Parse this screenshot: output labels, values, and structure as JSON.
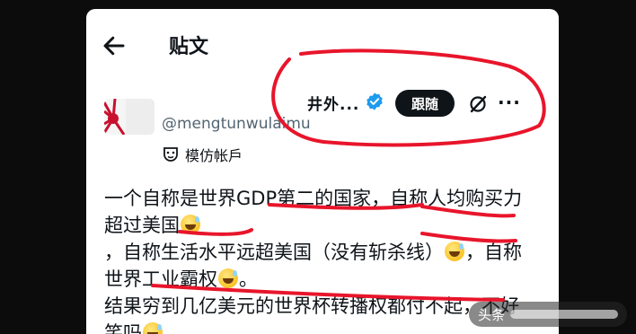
{
  "header": {
    "title": "贴文"
  },
  "author": {
    "display_name": "井外...",
    "handle": "@mengtunwulaimu",
    "follow_label": "跟随",
    "account_label": "模仿帐戶"
  },
  "tweet": {
    "seg1": "一个自称是世界GDP第二的国家，自称人均购买力超过美国",
    "seg2": "，自称生活水平远超美国（没有斩杀线）",
    "seg3": "，自称世界工业霸权",
    "seg4": "。",
    "seg5": "结果穷到几亿美元的世界杯转播权都付不起，不好笑吗"
  },
  "watermark": {
    "text": "头条"
  },
  "colors": {
    "annotation": "#e8152b",
    "verified": "#1d9bf0",
    "follow_bg": "#0f1419"
  },
  "icons": [
    "back-arrow-icon",
    "verified-badge-icon",
    "grok-icon",
    "more-icon",
    "parody-mask-icon",
    "grin-sweat-emoji-icon"
  ]
}
